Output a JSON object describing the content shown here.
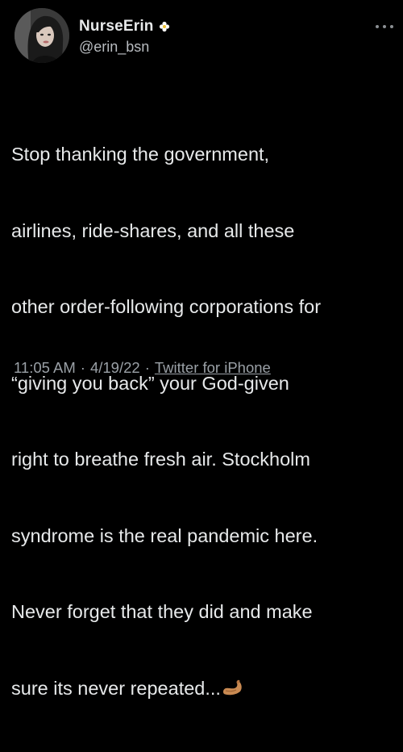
{
  "user": {
    "display_name": "NurseErin",
    "handle": "@erin_bsn",
    "badge_icon": "flower-icon",
    "avatar_icon": "profile-photo"
  },
  "tweet": {
    "lines": [
      "Stop thanking the government,",
      "airlines, ride-shares, and all these",
      "other order-following corporations for",
      "“giving you back” your God-given",
      "right to breathe fresh air. Stockholm",
      "syndrome is the real pandemic here.",
      "Never forget that they did and make",
      "sure its never repeated..."
    ],
    "trailing_emoji": "flexed-biceps-icon"
  },
  "meta": {
    "time": "11:05 AM",
    "separator": "·",
    "date": "4/19/22",
    "source": "Twitter for iPhone"
  },
  "colors": {
    "background": "#000000",
    "text": "#e7e9ea",
    "secondary_text": "#9aa0a6"
  }
}
